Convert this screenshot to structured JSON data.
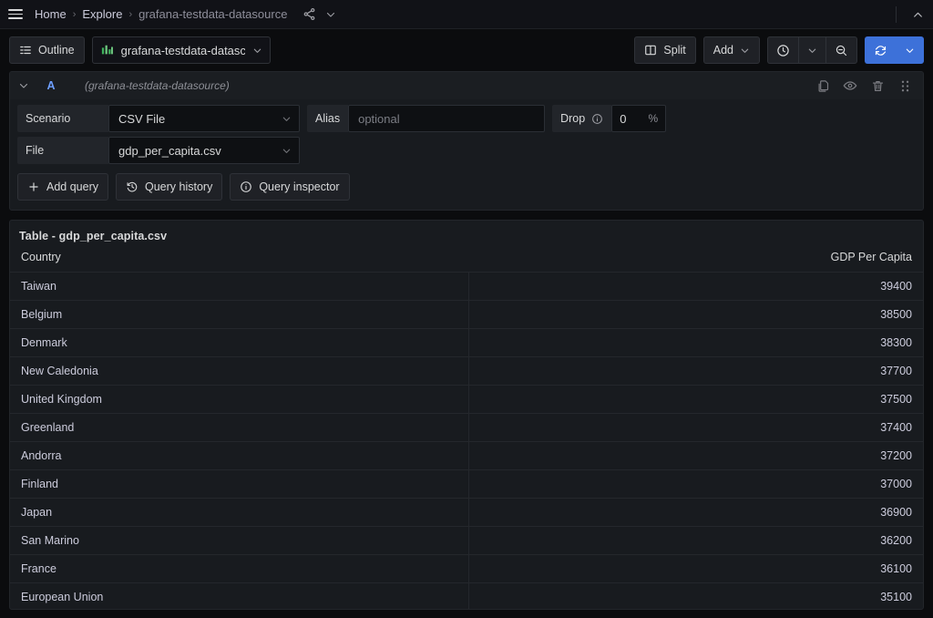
{
  "topbar": {
    "menu_icon": "hamburger-menu-icon",
    "breadcrumbs": [
      {
        "label": "Home",
        "current": false
      },
      {
        "label": "Explore",
        "current": false
      },
      {
        "label": "grafana-testdata-datasource",
        "current": true
      }
    ],
    "share_icon": "share-icon",
    "breadcrumb_dropdown_icon": "chevron-down-icon",
    "collapse_icon": "chevron-up-icon"
  },
  "toolbar": {
    "outline_label": "Outline",
    "outline_icon": "outline-list-icon",
    "datasource_name": "grafana-testdata-datasc",
    "datasource_icon": "datasource-bars-icon",
    "split_label": "Split",
    "split_icon": "split-panes-icon",
    "add_label": "Add",
    "add_caret_icon": "chevron-down-icon",
    "time_picker_icon": "clock-icon",
    "time_picker_caret_icon": "chevron-down-icon",
    "zoom_out_icon": "magnifier-minus-icon",
    "refresh_icon": "refresh-sync-icon",
    "refresh_caret_icon": "chevron-down-icon"
  },
  "query": {
    "collapse_icon": "chevron-down-icon",
    "ref_id": "A",
    "datasource_hint": "(grafana-testdata-datasource)",
    "actions": [
      {
        "name": "duplicate-query-icon",
        "title": "copy-icon"
      },
      {
        "name": "toggle-visibility-icon",
        "title": "eye-icon"
      },
      {
        "name": "remove-query-icon",
        "title": "trash-icon"
      },
      {
        "name": "drag-handle-icon",
        "title": "six-dots-icon"
      }
    ],
    "scenario_label": "Scenario",
    "scenario_value": "CSV File",
    "alias_label": "Alias",
    "alias_value": "",
    "alias_placeholder": "optional",
    "drop_label": "Drop",
    "drop_info_icon": "info-circle-icon",
    "drop_value": "0",
    "drop_suffix": "%",
    "file_label": "File",
    "file_value": "gdp_per_capita.csv",
    "select_caret_icon": "chevron-down-icon",
    "add_query_label": "Add query",
    "add_query_icon": "plus-icon",
    "query_history_label": "Query history",
    "query_history_icon": "history-icon",
    "query_inspector_label": "Query inspector",
    "query_inspector_icon": "info-circle-icon"
  },
  "panel": {
    "title": "Table - gdp_per_capita.csv"
  },
  "chart_data": {
    "type": "table",
    "title": "Table - gdp_per_capita.csv",
    "columns": [
      "Country",
      "GDP Per Capita"
    ],
    "column_align": [
      "left",
      "right"
    ],
    "rows": [
      [
        "Taiwan",
        "39400"
      ],
      [
        "Belgium",
        "38500"
      ],
      [
        "Denmark",
        "38300"
      ],
      [
        "New Caledonia",
        "37700"
      ],
      [
        "United Kingdom",
        "37500"
      ],
      [
        "Greenland",
        "37400"
      ],
      [
        "Andorra",
        "37200"
      ],
      [
        "Finland",
        "37000"
      ],
      [
        "Japan",
        "36900"
      ],
      [
        "San Marino",
        "36200"
      ],
      [
        "France",
        "36100"
      ],
      [
        "European Union",
        "35100"
      ]
    ],
    "xlabel": "Country",
    "ylabel": "GDP Per Capita"
  },
  "colors": {
    "page_bg": "#0b0c0e",
    "panel_bg": "#181b1f",
    "border": "#23262b",
    "accent_blue": "#3d71d9",
    "ref_id_blue": "#6e9fff",
    "datasource_green": "#3eb15b",
    "text": "#ccccdc",
    "text_muted": "#8d8f96"
  }
}
